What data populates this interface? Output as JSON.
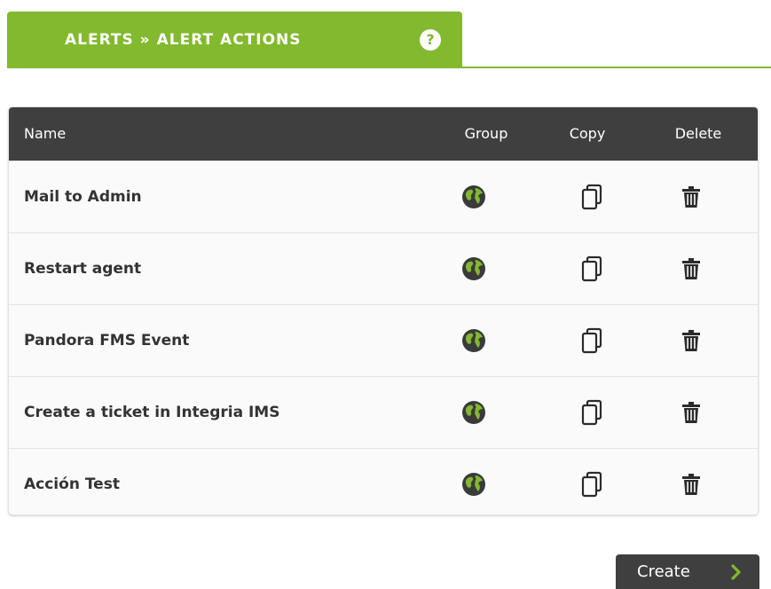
{
  "header": {
    "title": "ALERTS » ALERT ACTIONS",
    "help_symbol": "?",
    "help_icon": "help-icon",
    "accent_color": "#82b92e"
  },
  "table": {
    "columns": {
      "name": "Name",
      "group": "Group",
      "copy": "Copy",
      "delete": "Delete"
    },
    "header_bg": "#3f3f3f",
    "row_icons": {
      "group": "globe-icon",
      "copy": "copy-icon",
      "delete": "trash-icon"
    },
    "rows": [
      {
        "name": "Mail to Admin"
      },
      {
        "name": "Restart agent"
      },
      {
        "name": "Pandora FMS Event"
      },
      {
        "name": "Create a ticket in Integria IMS"
      },
      {
        "name": "Acción Test"
      }
    ]
  },
  "actions": {
    "create_label": "Create",
    "create_icon": "chevron-right-icon"
  }
}
